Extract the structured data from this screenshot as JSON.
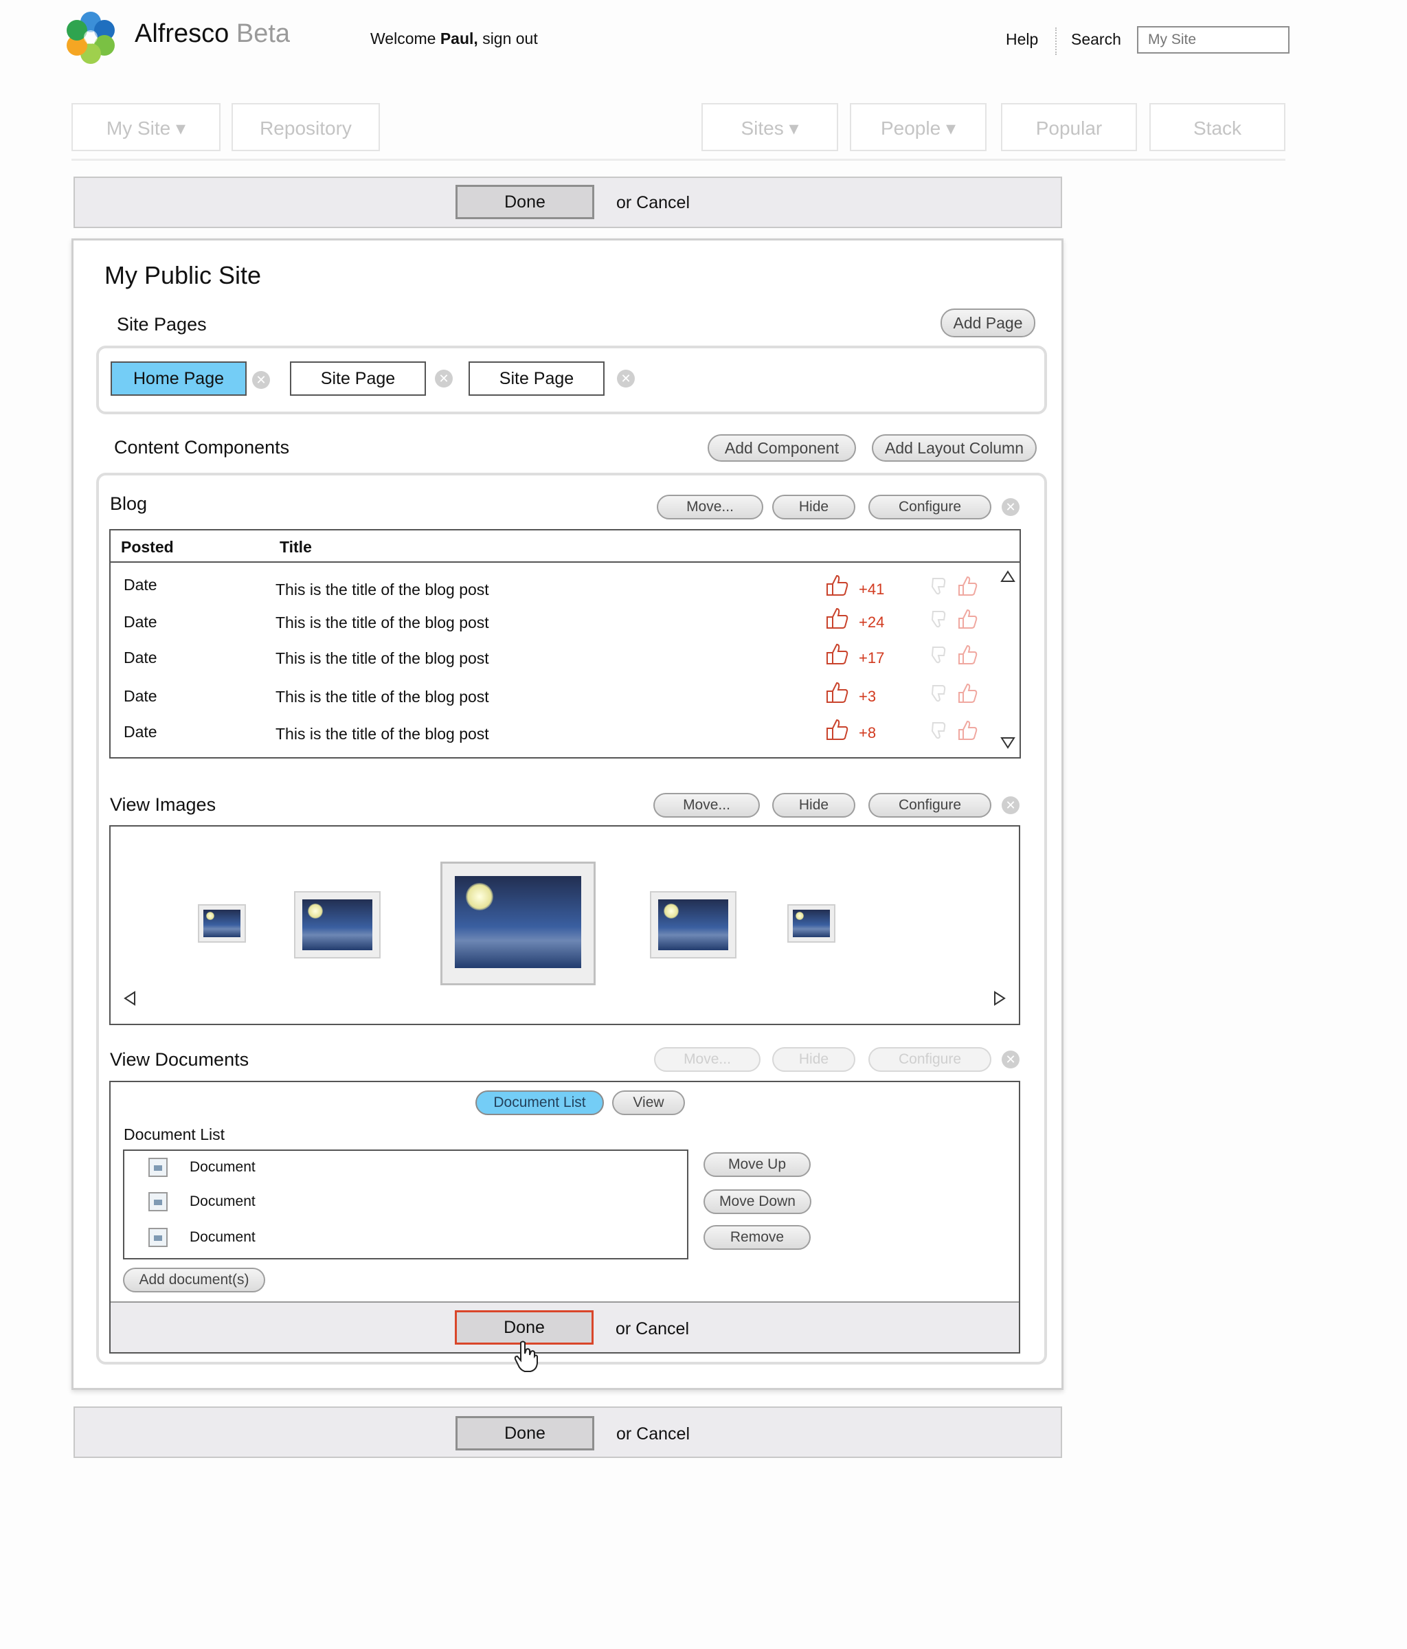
{
  "header": {
    "brand": "Alfresco",
    "brand_suffix": "Beta",
    "welcome_prefix": "Welcome",
    "user": "Paul,",
    "signout": "sign out",
    "help": "Help",
    "search": "Search",
    "search_placeholder": "My Site"
  },
  "nav": {
    "left": [
      {
        "label": "My Site ▾"
      },
      {
        "label": "Repository"
      }
    ],
    "right": [
      {
        "label": "Sites ▾"
      },
      {
        "label": "People ▾"
      },
      {
        "label": "Popular"
      },
      {
        "label": "Stack"
      }
    ]
  },
  "actions": {
    "done": "Done",
    "or_cancel": "or Cancel"
  },
  "site": {
    "title": "My Public Site",
    "pages_label": "Site Pages",
    "add_page": "Add Page",
    "pages": [
      "Home Page",
      "Site Page",
      "Site Page"
    ],
    "content_label": "Content Components",
    "add_component": "Add Component",
    "add_layout_column": "Add Layout Column"
  },
  "component_buttons": {
    "move": "Move...",
    "hide": "Hide",
    "configure": "Configure"
  },
  "blog": {
    "title": "Blog",
    "col_posted": "Posted",
    "col_title": "Title",
    "rows": [
      {
        "date": "Date",
        "title": "This is the title of the blog post",
        "score": "+41"
      },
      {
        "date": "Date",
        "title": "This is the title of the blog post",
        "score": "+24"
      },
      {
        "date": "Date",
        "title": "This is the title of the blog post",
        "score": "+17"
      },
      {
        "date": "Date",
        "title": "This is the title of the blog post",
        "score": "+3"
      },
      {
        "date": "Date",
        "title": "This is the title of the blog post",
        "score": "+8"
      }
    ]
  },
  "images": {
    "title": "View Images"
  },
  "documents": {
    "title": "View Documents",
    "tab_list": "Document List",
    "tab_view": "View",
    "list_label": "Document List",
    "items": [
      "Document",
      "Document",
      "Document"
    ],
    "move_up": "Move Up",
    "move_down": "Move Down",
    "remove": "Remove",
    "add_documents": "Add document(s)"
  },
  "colors": {
    "accent_blue": "#74cdf6",
    "score_red": "#d23a1f",
    "done_highlight": "#d9462a"
  }
}
